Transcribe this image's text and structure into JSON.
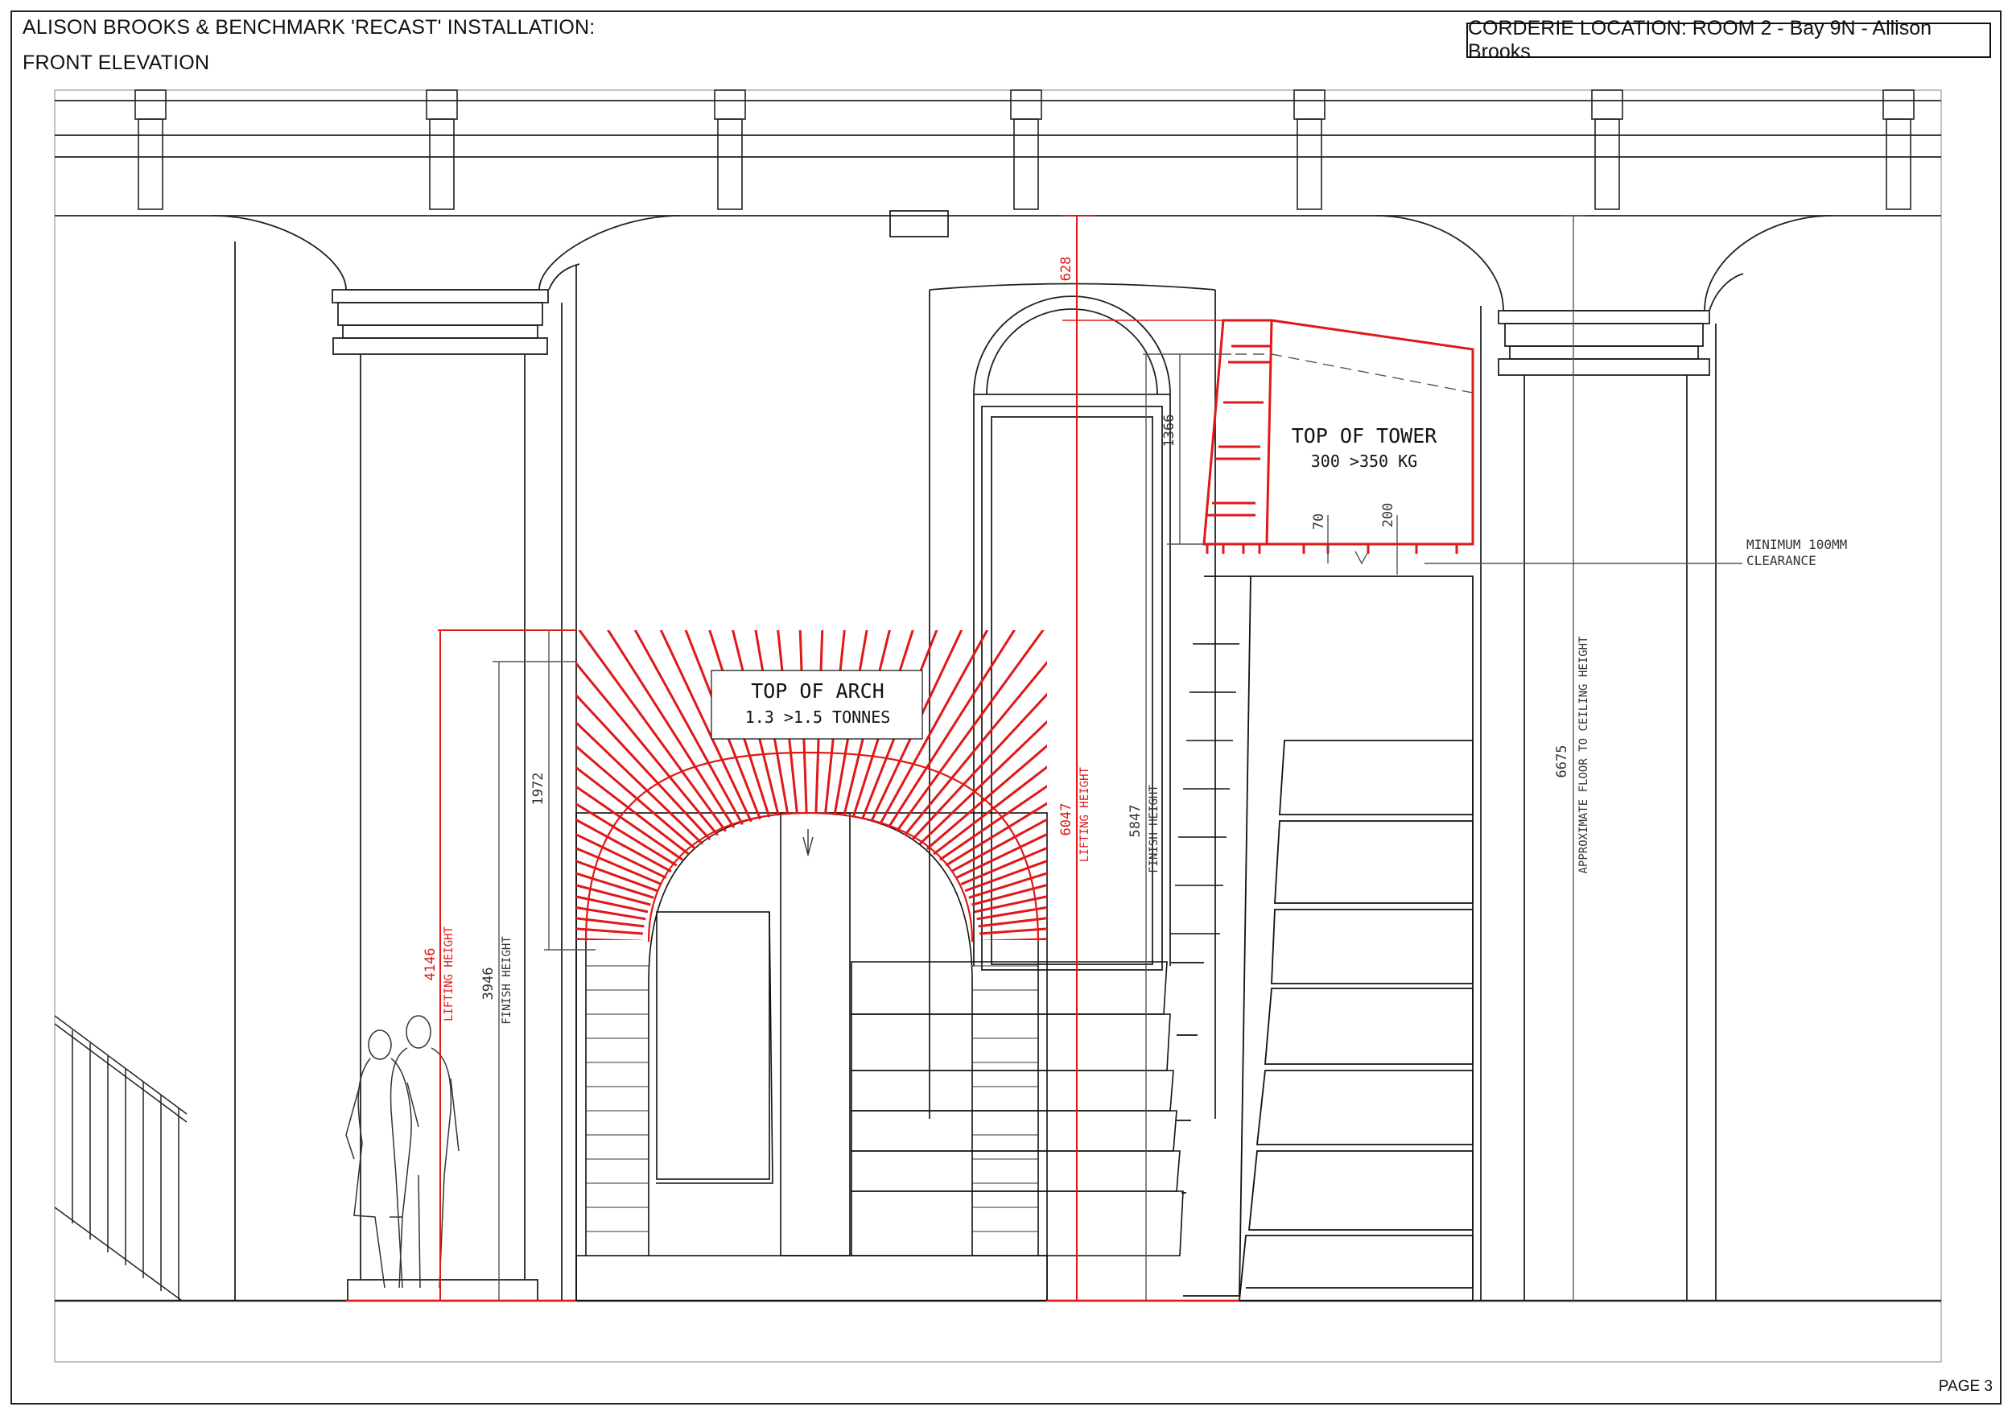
{
  "header": {
    "title_line_1": "ALISON BROOKS & BENCHMARK 'RECAST' INSTALLATION:",
    "title_line_2": "FRONT ELEVATION",
    "location": "CORDERIE LOCATION: ROOM 2 - Bay 9N - Allison Brooks"
  },
  "footer": {
    "page": "PAGE 3"
  },
  "colors": {
    "line": "#111111",
    "red": "#e01818",
    "grey": "#555555"
  },
  "labels": {
    "top_of_arch_title": "TOP OF ARCH",
    "top_of_arch_weight": "1.3 >1.5 TONNES",
    "top_of_tower_title": "TOP OF TOWER",
    "top_of_tower_weight": "300 >350 KG",
    "min_clearance_1": "MINIMUM 100MM",
    "min_clearance_2": "CLEARANCE"
  },
  "dimensions": {
    "d628": "628",
    "d1366": "1366",
    "d70": "70",
    "d200": "200",
    "d1972": "1972",
    "d4146": "4146",
    "lifting_height": "LIFTING HEIGHT",
    "d3946": "3946",
    "finish_height": "FINISH HEIGHT",
    "d6047": "6047",
    "d5847": "5847",
    "d6675": "6675",
    "ceiling_height": "APPROXIMATE FLOOR TO CEILING HEIGHT"
  }
}
